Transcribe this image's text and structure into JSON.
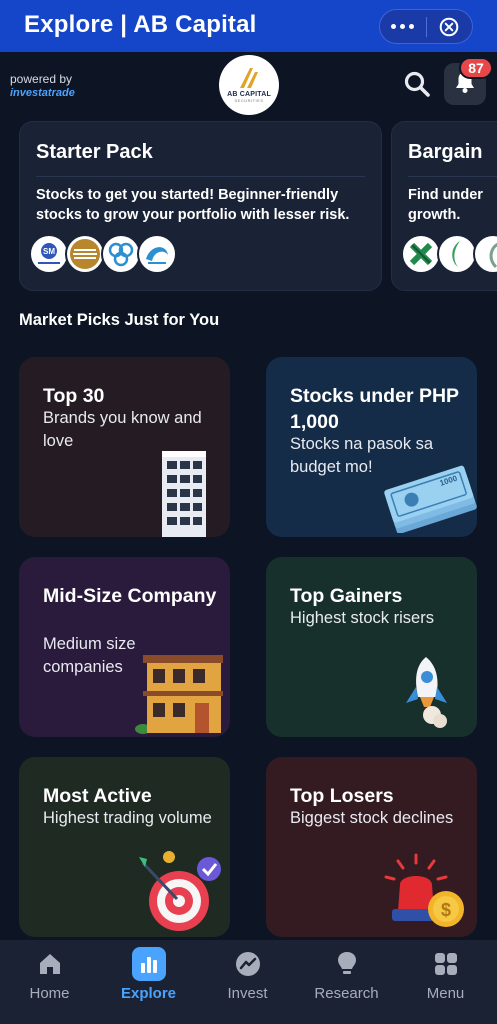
{
  "titlebar": {
    "title": "Explore | AB Capital",
    "more_icon": "more-horizontal-icon",
    "close_icon": "close-circle-icon"
  },
  "header": {
    "powered_label": "powered by",
    "powered_brand": "investatrade",
    "logo_text": "AB CAPITAL",
    "logo_subtext": "SECURITIES",
    "notification_count": "87"
  },
  "packs": [
    {
      "title": "Starter Pack",
      "description": "Stocks to get you started! Beginner-friendly stocks to grow your portfolio with lesser risk."
    },
    {
      "title": "Bargain",
      "description": "Find under growth."
    }
  ],
  "section_title": "Market Picks Just for You",
  "cards": [
    {
      "title": "Top 30",
      "subtitle": "Brands you know and love",
      "bg": "#241c22"
    },
    {
      "title": "Stocks under PHP 1,000",
      "subtitle": "Stocks na pasok sa budget mo!",
      "bg": "#152c48"
    },
    {
      "title": "Mid-Size Company",
      "subtitle": "Medium size companies",
      "bg": "#2a1a3c"
    },
    {
      "title": "Top Gainers",
      "subtitle": "Highest stock risers",
      "bg": "#18302c"
    },
    {
      "title": "Most Active",
      "subtitle": "Highest trading volume",
      "bg": "#1f2a22"
    },
    {
      "title": "Top Losers",
      "subtitle": "Biggest stock declines",
      "bg": "#341b22"
    }
  ],
  "nav": [
    {
      "label": "Home",
      "icon": "home-icon"
    },
    {
      "label": "Explore",
      "icon": "bar-chart-icon"
    },
    {
      "label": "Invest",
      "icon": "trend-icon"
    },
    {
      "label": "Research",
      "icon": "lightbulb-icon"
    },
    {
      "label": "Menu",
      "icon": "grid-icon"
    }
  ],
  "colors": {
    "titlebar": "#1546c9",
    "accent": "#4aa3ff",
    "badge": "#e8474a",
    "background": "#0d1424"
  }
}
